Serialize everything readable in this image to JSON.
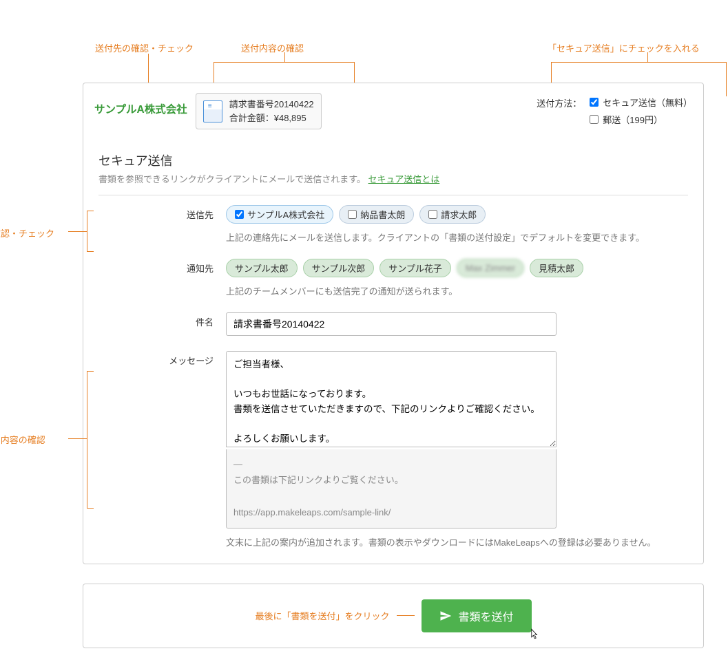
{
  "annotations": {
    "top1": "送付先の確認・チェック",
    "top2": "送付内容の確認",
    "top3": "「セキュア送信」にチェックを入れる",
    "side1": "送付先の確認・チェック",
    "side2": "メッセージ内容の確認",
    "bottom": "最後に「書類を送付」をクリック"
  },
  "header": {
    "company": "サンプルA株式会社",
    "document": {
      "title": "請求書番号20140422",
      "total_label": "合計金額：¥48,895"
    },
    "method_label": "送付方法：",
    "methods": [
      {
        "label": "セキュア送信（無料）",
        "checked": true
      },
      {
        "label": "郵送（199円）",
        "checked": false
      }
    ]
  },
  "section": {
    "title": "セキュア送信",
    "desc": "書類を参照できるリンクがクライアントにメールで送信されます。",
    "link": "セキュア送信とは"
  },
  "send_to": {
    "label": "送信先",
    "options": [
      {
        "label": "サンプルA株式会社",
        "checked": true
      },
      {
        "label": "納品書太朗",
        "checked": false
      },
      {
        "label": "請求太郎",
        "checked": false
      }
    ],
    "help": "上記の連絡先にメールを送信します。クライアントの「書類の送付設定」でデフォルトを変更できます。"
  },
  "notify_to": {
    "label": "通知先",
    "options": [
      "サンプル太郎",
      "サンプル次郎",
      "サンプル花子",
      "Max Zimmer",
      "見積太郎"
    ],
    "help": "上記のチームメンバーにも送信完了の通知が送られます。"
  },
  "subject": {
    "label": "件名",
    "value": "請求書番号20140422"
  },
  "message": {
    "label": "メッセージ",
    "value": "ご担当者様、\n\nいつもお世話になっております。\n書類を送信させていただきますので、下記のリンクよりご確認ください。\n\nよろしくお願いします。",
    "footer": "—\nこの書類は下記リンクよりご覧ください。\n\nhttps://app.makeleaps.com/sample-link/",
    "help": "文末に上記の案内が追加されます。書類の表示やダウンロードにはMakeLeapsへの登録は必要ありません。"
  },
  "send_button": "書類を送付"
}
